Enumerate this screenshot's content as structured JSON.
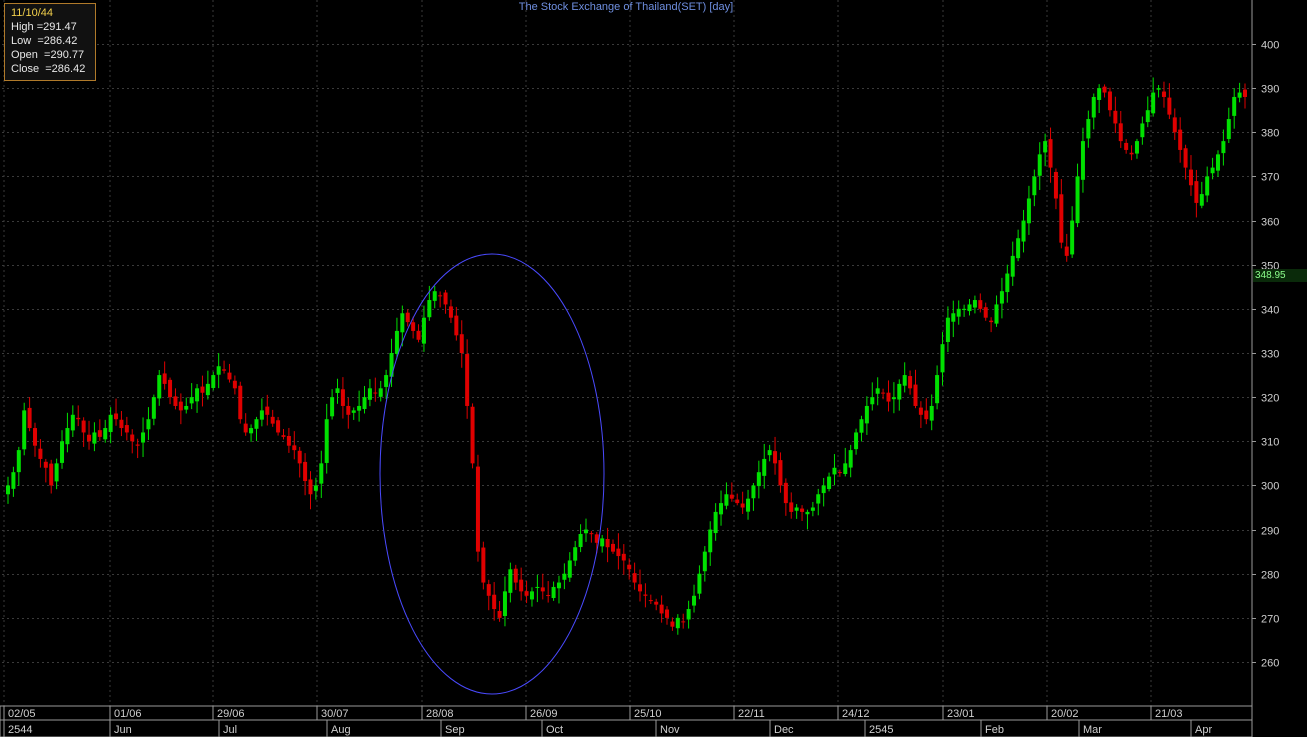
{
  "title": "The Stock Exchange of Thailand(SET) [day]",
  "infobox": {
    "date": "11/10/44",
    "high_label": "High",
    "high": "=291.47",
    "low_label": "Low",
    "low": "=286.42",
    "open_label": "Open",
    "open": "=290.77",
    "close_label": "Close",
    "close": "=286.42"
  },
  "current_price": "348.95",
  "colors": {
    "up": "#00e000",
    "down": "#e00000",
    "grid": "#3a3a3a",
    "axis": "#cfcfcf",
    "ellipse": "#4a4aff"
  },
  "chart_data": {
    "type": "candlestick",
    "title": "The Stock Exchange of Thailand(SET) [day]",
    "ylim": [
      250,
      410
    ],
    "y_ticks": [
      260,
      270,
      280,
      290,
      300,
      310,
      320,
      330,
      340,
      350,
      360,
      370,
      380,
      390,
      400
    ],
    "x_date_labels": [
      "02/05",
      "01/06",
      "29/06",
      "30/07",
      "28/08",
      "26/09",
      "25/10",
      "22/11",
      "24/12",
      "23/01",
      "20/02",
      "21/03"
    ],
    "x_month_labels": [
      "2544",
      "Jun",
      "Jul",
      "Aug",
      "Sep",
      "Oct",
      "Nov",
      "Dec",
      "2545",
      "Feb",
      "Mar",
      "Apr"
    ],
    "grid": true,
    "annotation": "ellipse around the September drop",
    "close_series": [
      300,
      303,
      308,
      317,
      313,
      309,
      306,
      304,
      300,
      305,
      310,
      313,
      316,
      315,
      312,
      310,
      312,
      311,
      313,
      316,
      315,
      313,
      312,
      310,
      309,
      312,
      315,
      320,
      325,
      323,
      320,
      318,
      317,
      318,
      320,
      322,
      321,
      323,
      325,
      327,
      326,
      324,
      322,
      315,
      312,
      313,
      315,
      317,
      316,
      314,
      312,
      311,
      309,
      308,
      305,
      301,
      298,
      300,
      305,
      315,
      320,
      322,
      318,
      316,
      317,
      318,
      320,
      322,
      321,
      322,
      325,
      330,
      335,
      339,
      337,
      335,
      333,
      338,
      342,
      344,
      343,
      341,
      338,
      334,
      330,
      318,
      305,
      285,
      278,
      275,
      272,
      270,
      276,
      281,
      278,
      276,
      275,
      276,
      277,
      276,
      275,
      277,
      278,
      280,
      283,
      286,
      289,
      290,
      289,
      287,
      288,
      286,
      285,
      284,
      283,
      281,
      278,
      276,
      275,
      274,
      273,
      271,
      270,
      268,
      270,
      269,
      272,
      275,
      280,
      285,
      290,
      294,
      296,
      298,
      297,
      296,
      295,
      297,
      300,
      303,
      306,
      308,
      305,
      300,
      296,
      294,
      295,
      294,
      294,
      295,
      298,
      300,
      302,
      304,
      303,
      305,
      308,
      312,
      315,
      318,
      320,
      322,
      321,
      319,
      320,
      323,
      325,
      322,
      318,
      316,
      315,
      318,
      325,
      332,
      338,
      339,
      340,
      340,
      341,
      342,
      340,
      338,
      337,
      341,
      344,
      348,
      352,
      356,
      360,
      365,
      370,
      375,
      378,
      372,
      365,
      355,
      352,
      360,
      370,
      378,
      383,
      388,
      390,
      389,
      385,
      382,
      378,
      376,
      375,
      378,
      382,
      385,
      389,
      390,
      388,
      384,
      380,
      376,
      372,
      368,
      364,
      366,
      370,
      372,
      375,
      378,
      383,
      388,
      389,
      388
    ]
  },
  "x_axis": {
    "date_labels": [
      "02/05",
      "01/06",
      "29/06",
      "30/07",
      "28/08",
      "26/09",
      "25/10",
      "22/11",
      "24/12",
      "23/01",
      "20/02",
      "21/03"
    ],
    "month_labels": [
      "2544",
      "Jun",
      "Jul",
      "Aug",
      "Sep",
      "Oct",
      "Nov",
      "Dec",
      "2545",
      "Feb",
      "Mar",
      "Apr"
    ]
  }
}
